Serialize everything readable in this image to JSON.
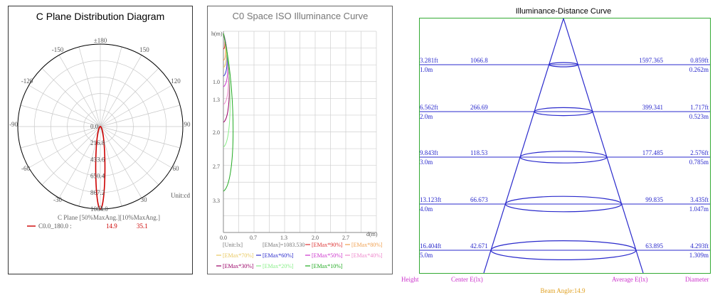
{
  "colors": {
    "frame": "#333333",
    "grid": "#c8c8c8",
    "polar_curve": "#cc0000",
    "axis_text": "#555555",
    "iso_frame": "#666666",
    "iso_grid": "#cfcfcf",
    "distance_frame": "#33aa33",
    "distance_lines": "#2a2acc",
    "magenta_label": "#cc33cc",
    "beam_label": "#e0a020"
  },
  "polar": {
    "title": "C Plane Distribution Diagram",
    "angle_labels": {
      "top": "±180",
      "l150": "-150",
      "r150": "150",
      "l120": "-120",
      "r120": "120",
      "l90": "-90",
      "r90": "90",
      "l60": "-60",
      "r60": "60",
      "l30": "-30",
      "r30": "30",
      "bottom": "0"
    },
    "radial_labels": [
      "0.0",
      "216.8",
      "433.6",
      "650.4",
      "867.2",
      "1084.0"
    ],
    "unit": "Unit:cd",
    "legend_header": "C Plane   [50%MaxAng.][10%MaxAng.]",
    "legend_row": {
      "name": "C0.0_180.0  :",
      "half_angle": "14.9",
      "tenth_angle": "35.1"
    }
  },
  "iso": {
    "title": "C0 Space ISO Illuminance Curve",
    "y_axis_label": "h(m)",
    "x_axis_label": "d(m)",
    "y_ticks": [
      "1.0",
      "1.3",
      "2.0",
      "2.7",
      "3.3"
    ],
    "x_ticks": [
      "0.0",
      "0.7",
      "1.3",
      "2.0",
      "2.7"
    ],
    "unit": "[Unit:lx]",
    "emax": "[EMax]=1083.530",
    "legend": [
      {
        "label": "[EMax*90%]",
        "color": "#dd3333"
      },
      {
        "label": "[EMax*80%]",
        "color": "#f0a050"
      },
      {
        "label": "[EMax*70%]",
        "color": "#e8c860"
      },
      {
        "label": "[EMax*60%]",
        "color": "#2a2acc"
      },
      {
        "label": "[EMax*50%]",
        "color": "#cc33cc"
      },
      {
        "label": "[EMax*40%]",
        "color": "#ee88cc"
      },
      {
        "label": "[EMax*30%]",
        "color": "#990066"
      },
      {
        "label": "[EMax*20%]",
        "color": "#88ee88"
      },
      {
        "label": "[EMax*10%]",
        "color": "#22aa22"
      }
    ]
  },
  "distance": {
    "title": "Illuminance-Distance Curve",
    "rows": [
      {
        "ft": "3.281ft",
        "m": "1.0m",
        "center": "1066.8",
        "average": "1597.365",
        "dia_ft": "0.859ft",
        "dia_m": "0.262m"
      },
      {
        "ft": "6.562ft",
        "m": "2.0m",
        "center": "266.69",
        "average": "399.341",
        "dia_ft": "1.717ft",
        "dia_m": "0.523m"
      },
      {
        "ft": "9.843ft",
        "m": "3.0m",
        "center": "118.53",
        "average": "177.485",
        "dia_ft": "2.576ft",
        "dia_m": "0.785m"
      },
      {
        "ft": "13.123ft",
        "m": "4.0m",
        "center": "66.673",
        "average": "99.835",
        "dia_ft": "3.435ft",
        "dia_m": "1.047m"
      },
      {
        "ft": "16.404ft",
        "m": "5.0m",
        "center": "42.671",
        "average": "63.895",
        "dia_ft": "4.293ft",
        "dia_m": "1.309m"
      }
    ],
    "footer": {
      "height": "Height",
      "center": "Center E(lx)",
      "average": "Average E(lx)",
      "diameter": "Diameter",
      "beam_angle": "Beam Angle:14.9"
    }
  }
}
